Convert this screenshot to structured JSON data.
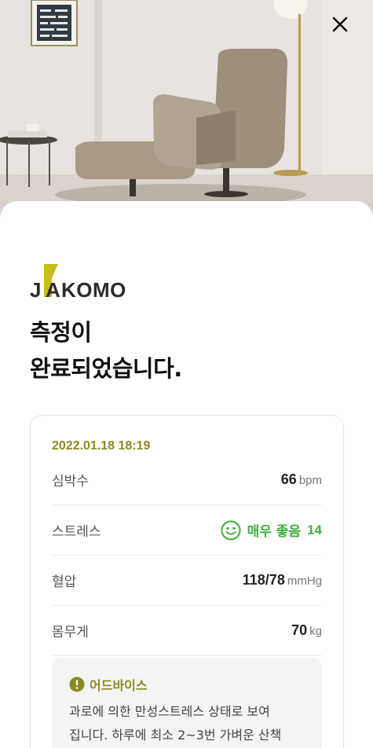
{
  "header": {
    "close_icon": "close-icon"
  },
  "brand": {
    "name": "JAKOMO",
    "accent_color": "#c8be1e"
  },
  "title": {
    "line1": "측정이",
    "line2": "완료되었습니다."
  },
  "result": {
    "datetime": "2022.01.18 18:19",
    "rows": [
      {
        "label": "심박수",
        "value": "66",
        "unit": "bpm"
      },
      {
        "label": "스트레스",
        "status_text": "매우 좋음",
        "value": "14",
        "icon": "smile-face-icon",
        "color": "#3fae3f"
      },
      {
        "label": "혈압",
        "value": "118/78",
        "unit": "mmHg"
      },
      {
        "label": "몸무게",
        "value": "70",
        "unit": "kg"
      }
    ]
  },
  "advice": {
    "title": "어드바이스",
    "icon": "exclamation-circle-icon",
    "line1": "과로에 의한 만성스트레스 상태로 보여",
    "line2": "집니다. 하루에 최소 2~3번 가벼운 산책"
  }
}
